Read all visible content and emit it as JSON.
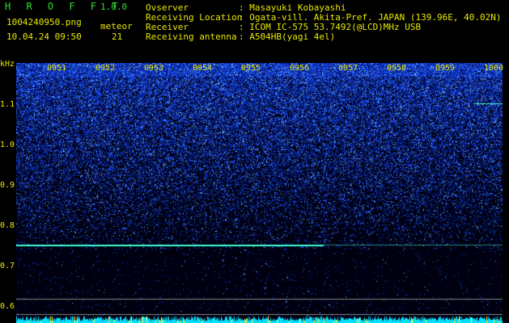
{
  "app": {
    "title": "H R O F F T",
    "version": "1.0.0"
  },
  "file": {
    "name": "1004240950.png",
    "datetime": "10.04.24 09:50"
  },
  "meteor": {
    "label": "meteor",
    "count": "21"
  },
  "info": [
    {
      "label": "Ovserver",
      "value": ": Masayuki Kobayashi"
    },
    {
      "label": "Receiving Location",
      "value": ": Ogata-vill. Akita-Pref. JAPAN (139.96E, 40.02N)"
    },
    {
      "label": "Receiver",
      "value": ": ICOM IC-575 53.7492(@LCD)MHz USB"
    },
    {
      "label": "Receiving antenna",
      "value": ": A504HB(yagi 4el)"
    }
  ],
  "spectrogram": {
    "y_unit": "kHz",
    "y_ticks": [
      "1.1",
      "1.0",
      "0.9",
      "0.8",
      "0.7",
      "0.6"
    ],
    "x_ticks": [
      "0951",
      "0952",
      "0953",
      "0954",
      "0955",
      "0956",
      "0957",
      "0958",
      "0959",
      "1000"
    ],
    "colors": {
      "background": "#000010",
      "signal": "#1a4dff",
      "bright": "#7fbfff",
      "carrier": "#40ffd0",
      "baseline": "#00e0ff"
    }
  }
}
